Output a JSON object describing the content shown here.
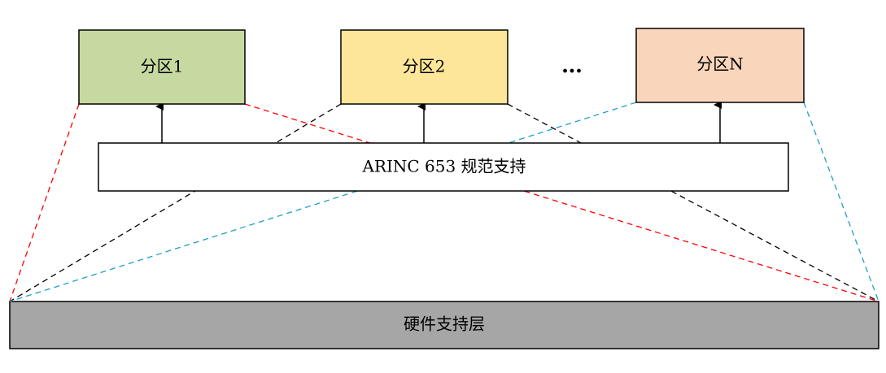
{
  "partitions": [
    {
      "label": "分区1",
      "fill": "#c6d9a0"
    },
    {
      "label": "分区2",
      "fill": "#fde699"
    },
    {
      "label": "分区N",
      "fill": "#f9d5bb"
    }
  ],
  "ellipsis": "…",
  "middleware": {
    "label": "ARINC 653 规范支持",
    "fill": "#ffffff"
  },
  "hardware": {
    "label": "硬件支持层",
    "fill": "#a6a6a6"
  },
  "colors": {
    "partition1_lines": "#ff0000",
    "partition2_lines": "#000000",
    "partitionN_lines": "#1f9fc4",
    "border": "#000000"
  }
}
